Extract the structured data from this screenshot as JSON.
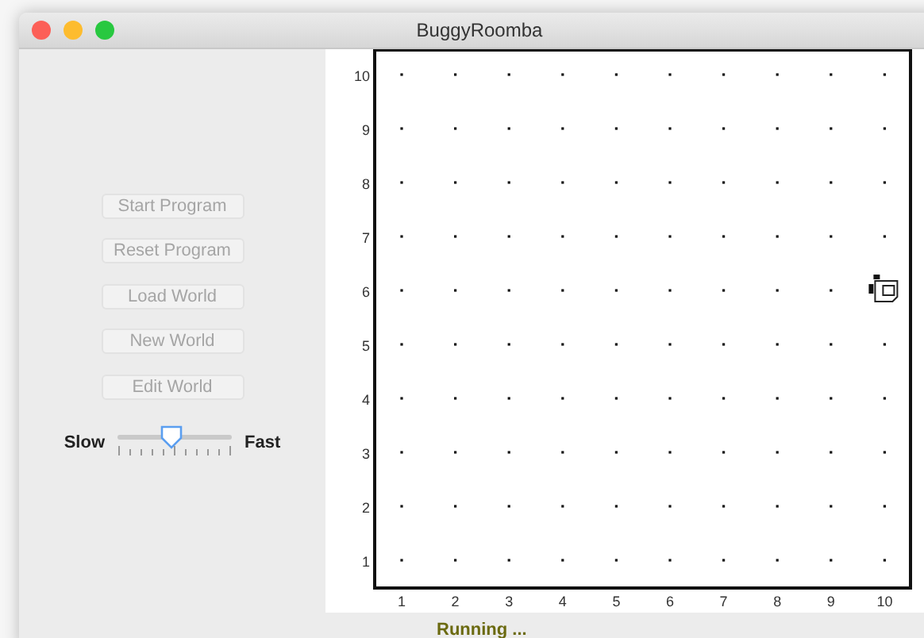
{
  "window": {
    "title": "BuggyRoomba"
  },
  "controls": [
    {
      "label": "Start Program",
      "disabled": true
    },
    {
      "label": "Reset Program",
      "disabled": true
    },
    {
      "label": "Load World",
      "disabled": true
    },
    {
      "label": "New World",
      "disabled": true
    },
    {
      "label": "Edit World",
      "disabled": true
    }
  ],
  "speed": {
    "min_label": "Slow",
    "max_label": "Fast",
    "level": 0.47
  },
  "world": {
    "rows": [
      "10",
      "9",
      "8",
      "7",
      "6",
      "5",
      "4",
      "3",
      "2",
      "1"
    ],
    "columns": [
      "1",
      "2",
      "3",
      "4",
      "5",
      "6",
      "7",
      "8",
      "9",
      "10"
    ]
  },
  "status_bar": {
    "text": "Running ..."
  }
}
